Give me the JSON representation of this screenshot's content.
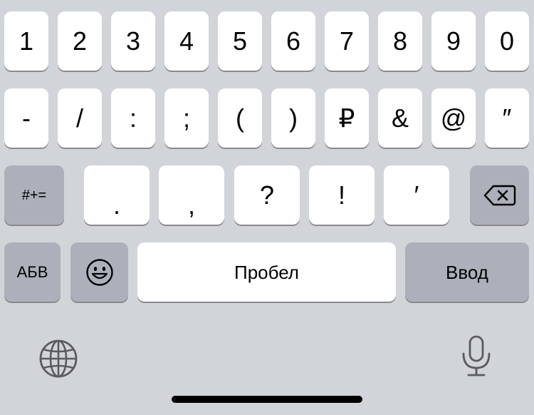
{
  "keyboard": {
    "row1": [
      "1",
      "2",
      "3",
      "4",
      "5",
      "6",
      "7",
      "8",
      "9",
      "0"
    ],
    "row2": [
      "-",
      "/",
      ":",
      ";",
      "(",
      ")",
      "₽",
      "&",
      "@",
      "″"
    ],
    "row3": {
      "symbols_toggle": "#+=",
      "keys": [
        ".",
        ",",
        "?",
        "!",
        "′"
      ],
      "backspace_icon": "backspace-icon"
    },
    "row4": {
      "letters_toggle": "АБВ",
      "emoji_icon": "emoji-icon",
      "space": "Пробел",
      "return": "Ввод"
    },
    "bottom": {
      "globe_icon": "globe-icon",
      "mic_icon": "microphone-icon"
    },
    "colors": {
      "background": "#d1d4d9",
      "key": "#ffffff",
      "function_key": "#abb0bb",
      "key_shadow": "#898a8d"
    }
  }
}
